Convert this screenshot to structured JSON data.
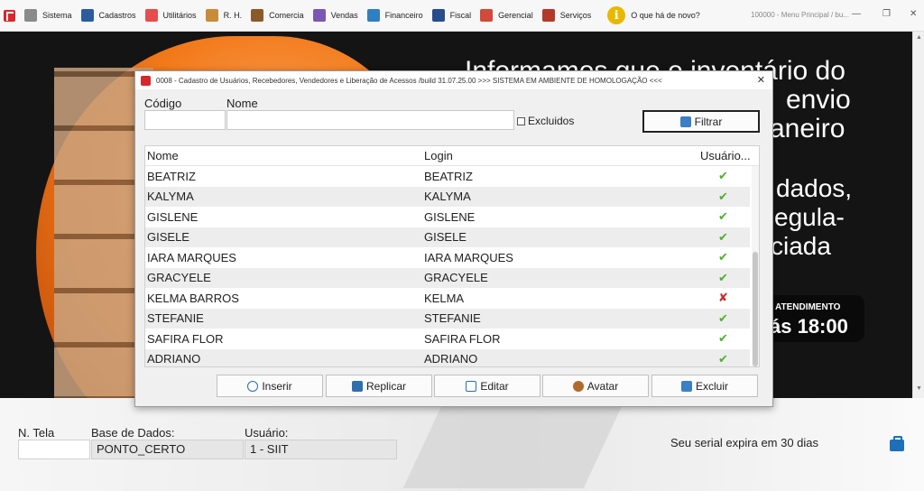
{
  "menubar": {
    "items": [
      {
        "label": "Sistema",
        "icon": "sistema-icon",
        "color": "#8a8a8a"
      },
      {
        "label": "Cadastros",
        "icon": "cadastros-icon",
        "color": "#2b5d9e"
      },
      {
        "label": "Utilitários",
        "icon": "utilitarios-icon",
        "color": "#e84d4d"
      },
      {
        "label": "R. H.",
        "icon": "rh-icon",
        "color": "#c78b3a"
      },
      {
        "label": "Comercia",
        "icon": "comercial-icon",
        "color": "#8b5a2b"
      },
      {
        "label": "Vendas",
        "icon": "vendas-icon",
        "color": "#7b57b5"
      },
      {
        "label": "Financeiro",
        "icon": "financeiro-icon",
        "color": "#2f7fc1"
      },
      {
        "label": "Fiscal",
        "icon": "fiscal-icon",
        "color": "#274d8c"
      },
      {
        "label": "Gerencial",
        "icon": "gerencial-icon",
        "color": "#d24a3a"
      },
      {
        "label": "Serviços",
        "icon": "servicos-icon",
        "color": "#b33a2a"
      }
    ],
    "news_label": "O que há de novo?",
    "window_title": "100000 - Menu Principal / bu..."
  },
  "banner": {
    "line1": "Informamos que o inventário do",
    "line2": "envio",
    "line3": "aneiro",
    "line4": "dados,",
    "line5": "egula-",
    "line6": "ciada",
    "pill_label": "ATENDIMENTO",
    "pill_time": "ás 18:00"
  },
  "dialog": {
    "title": "0008 - Cadastro de Usuários, Recebedores, Vendedores e Liberação de Acessos /build 31.07.25.00 >>> SISTEMA EM AMBIENTE DE HOMOLOGAÇÃO <<<",
    "codigo_label": "Código",
    "nome_label": "Nome",
    "excluidos_label": "Excluidos",
    "filtrar_label": "Filtrar",
    "columns": {
      "nome": "Nome",
      "login": "Login",
      "usuario": "Usuário..."
    },
    "rows": [
      {
        "nome": "BEATRIZ",
        "login": "BEATRIZ",
        "active": true
      },
      {
        "nome": "KALYMA",
        "login": "KALYMA",
        "active": true
      },
      {
        "nome": "GISLENE",
        "login": "GISLENE",
        "active": true
      },
      {
        "nome": "GISELE",
        "login": "GISELE",
        "active": true
      },
      {
        "nome": "IARA MARQUES",
        "login": "IARA MARQUES",
        "active": true
      },
      {
        "nome": "GRACYELE",
        "login": "GRACYELE",
        "active": true
      },
      {
        "nome": "KELMA BARROS",
        "login": "KELMA",
        "active": false
      },
      {
        "nome": "STEFANIE",
        "login": "STEFANIE",
        "active": true
      },
      {
        "nome": "SAFIRA FLOR",
        "login": "SAFIRA FLOR",
        "active": true
      },
      {
        "nome": "ADRIANO",
        "login": "ADRIANO",
        "active": true
      }
    ],
    "buttons": {
      "inserir": "Inserir",
      "replicar": "Replicar",
      "editar": "Editar",
      "avatar": "Avatar",
      "excluir": "Excluir"
    }
  },
  "statusbar": {
    "ntela_label": "N. Tela",
    "base_label": "Base de Dados:",
    "base_value": "PONTO_CERTO",
    "usuario_label": "Usuário:",
    "usuario_value": "1 - SIIT",
    "serial_text": "Seu serial expira em 30 dias"
  }
}
